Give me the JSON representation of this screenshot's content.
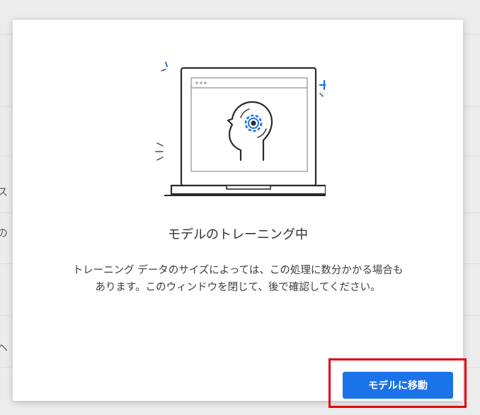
{
  "background": {
    "fragments": [
      "ス",
      "の",
      "ヘ"
    ]
  },
  "dialog": {
    "illustration": {
      "icon": "laptop-head-gear-illustration",
      "accent": "#1a73e8"
    },
    "title": "モデルのトレーニング中",
    "body_line1": "トレーニング データのサイズによっては、この処理に数分かかる場合も",
    "body_line2": "あります。このウィンドウを閉じて、後で確認してください。",
    "button_label": "モデルに移動"
  },
  "colors": {
    "primary": "#1a73e8",
    "highlight": "#e3000f"
  }
}
